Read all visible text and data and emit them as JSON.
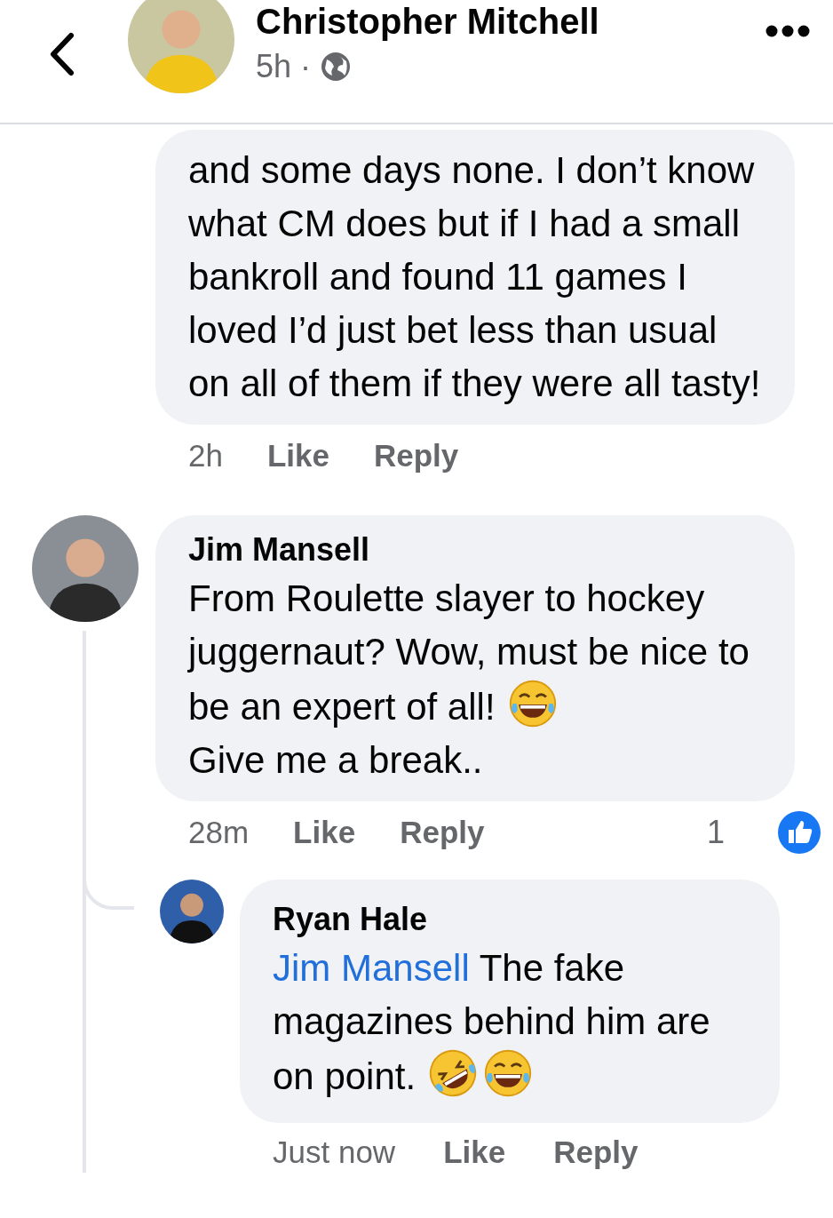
{
  "header": {
    "author": "Christopher Mitchell",
    "time": "5h",
    "separator": "·"
  },
  "comments": [
    {
      "paragraphs": [
        {
          "text": "and some days none. I don’t know what CM does but if I had a small bankroll and found 11 games I loved I’d just bet less than usual on all of them if they were all tasty!"
        }
      ],
      "time": "2h",
      "actions": [
        "Like",
        "Reply"
      ]
    },
    {
      "author": "Jim Mansell",
      "paragraphs": [
        {
          "text": "From Roulette slayer to hockey juggernaut? Wow, must be nice to be an expert of all!",
          "emojis": [
            {
              "kind": "joy"
            }
          ]
        },
        {
          "text": "Give me a break.."
        }
      ],
      "time": "28m",
      "actions": [
        "Like",
        "Reply"
      ],
      "reactions": {
        "count": "1"
      },
      "replies": [
        {
          "author": "Ryan Hale",
          "mention": "Jim Mansell",
          "paragraphs": [
            {
              "text": "The fake magazines behind him are on point.",
              "emojis": [
                {
                  "kind": "rofl"
                },
                {
                  "kind": "joy"
                }
              ]
            }
          ],
          "time": "Just now",
          "actions": [
            "Like",
            "Reply"
          ]
        }
      ]
    }
  ]
}
